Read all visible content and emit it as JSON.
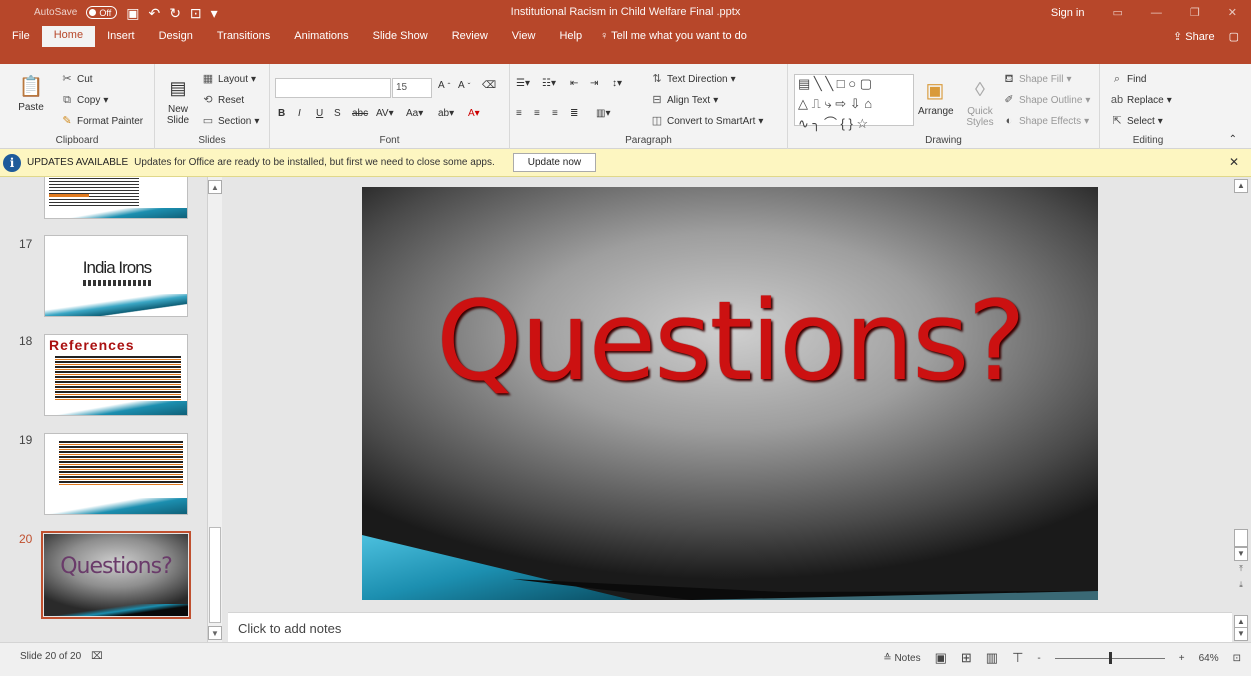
{
  "titlebar": {
    "autosave_label": "AutoSave",
    "autosave_state": "Off",
    "doc_title": "Institutional Racism in Child Welfare Final .pptx",
    "sign_in": "Sign in"
  },
  "tabs": [
    {
      "label": "File"
    },
    {
      "label": "Home",
      "active": true
    },
    {
      "label": "Insert"
    },
    {
      "label": "Design"
    },
    {
      "label": "Transitions"
    },
    {
      "label": "Animations"
    },
    {
      "label": "Slide Show"
    },
    {
      "label": "Review"
    },
    {
      "label": "View"
    },
    {
      "label": "Help"
    }
  ],
  "tellme": "Tell me what you want to do",
  "share": "Share",
  "ribbon": {
    "clipboard": {
      "label": "Clipboard",
      "paste": "Paste",
      "cut": "Cut",
      "copy": "Copy",
      "format_painter": "Format Painter"
    },
    "slides": {
      "label": "Slides",
      "new_slide": "New Slide",
      "layout": "Layout",
      "reset": "Reset",
      "section": "Section"
    },
    "font": {
      "label": "Font",
      "size": "15"
    },
    "paragraph": {
      "label": "Paragraph",
      "text_direction": "Text Direction",
      "align_text": "Align Text",
      "convert_smartart": "Convert to SmartArt"
    },
    "drawing": {
      "label": "Drawing",
      "arrange": "Arrange",
      "quick_styles": "Quick Styles",
      "shape_fill": "Shape Fill",
      "shape_outline": "Shape Outline",
      "shape_effects": "Shape Effects"
    },
    "editing": {
      "label": "Editing",
      "find": "Find",
      "replace": "Replace",
      "select": "Select"
    }
  },
  "notification": {
    "title": "UPDATES AVAILABLE",
    "message": "Updates for Office are ready to be installed, but first we need to close some apps.",
    "button": "Update now"
  },
  "thumbnails": [
    {
      "number": "17",
      "title": "India Irons"
    },
    {
      "number": "18",
      "title": "References"
    },
    {
      "number": "19",
      "title": ""
    },
    {
      "number": "20",
      "title": "Questions?"
    }
  ],
  "slide": {
    "title": "Questions?"
  },
  "notes_placeholder": "Click to add notes",
  "status": {
    "slide_info": "Slide 20 of 20",
    "notes_btn": "Notes",
    "zoom": "64%",
    "zoom_minus": "-",
    "zoom_plus": "+"
  },
  "colors": {
    "accent": "#b7472a",
    "slide_title": "#cc1111",
    "teal": "#1c8fb0"
  }
}
